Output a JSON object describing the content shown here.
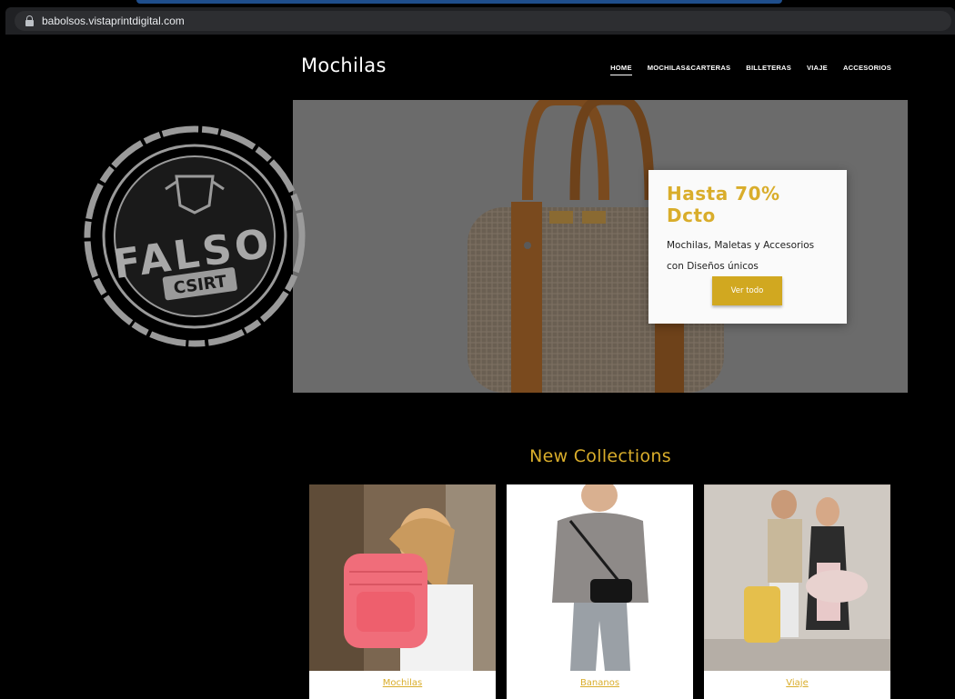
{
  "browser": {
    "url": "babolsos.vistaprintdigital.com"
  },
  "header": {
    "logo": "Mochilas",
    "nav": [
      "HOME",
      "MOCHILAS&CARTERAS",
      "BILLETERAS",
      "VIAJE",
      "ACCESORIOS"
    ],
    "active_nav": "HOME"
  },
  "hero": {
    "promo_title": "Hasta 70% Dcto",
    "promo_line1": "Mochilas, Maletas y Accesorios",
    "promo_line2": "con Diseños únicos",
    "button_label": "Ver todo"
  },
  "stamp": {
    "word": "FALSO",
    "label": "CSIRT"
  },
  "collections": {
    "title": "New Collections",
    "cards": [
      {
        "label": "Mochilas",
        "icon": "pink-backpack-photo"
      },
      {
        "label": "Bananos",
        "icon": "crossbody-bag-photo"
      },
      {
        "label": "Viaje",
        "icon": "travel-bags-photo"
      }
    ]
  },
  "colors": {
    "accent_gold": "#d9ad2b",
    "button_gold": "#d1a820",
    "background": "#000000",
    "hero_overlay": "#6b6b6b"
  }
}
